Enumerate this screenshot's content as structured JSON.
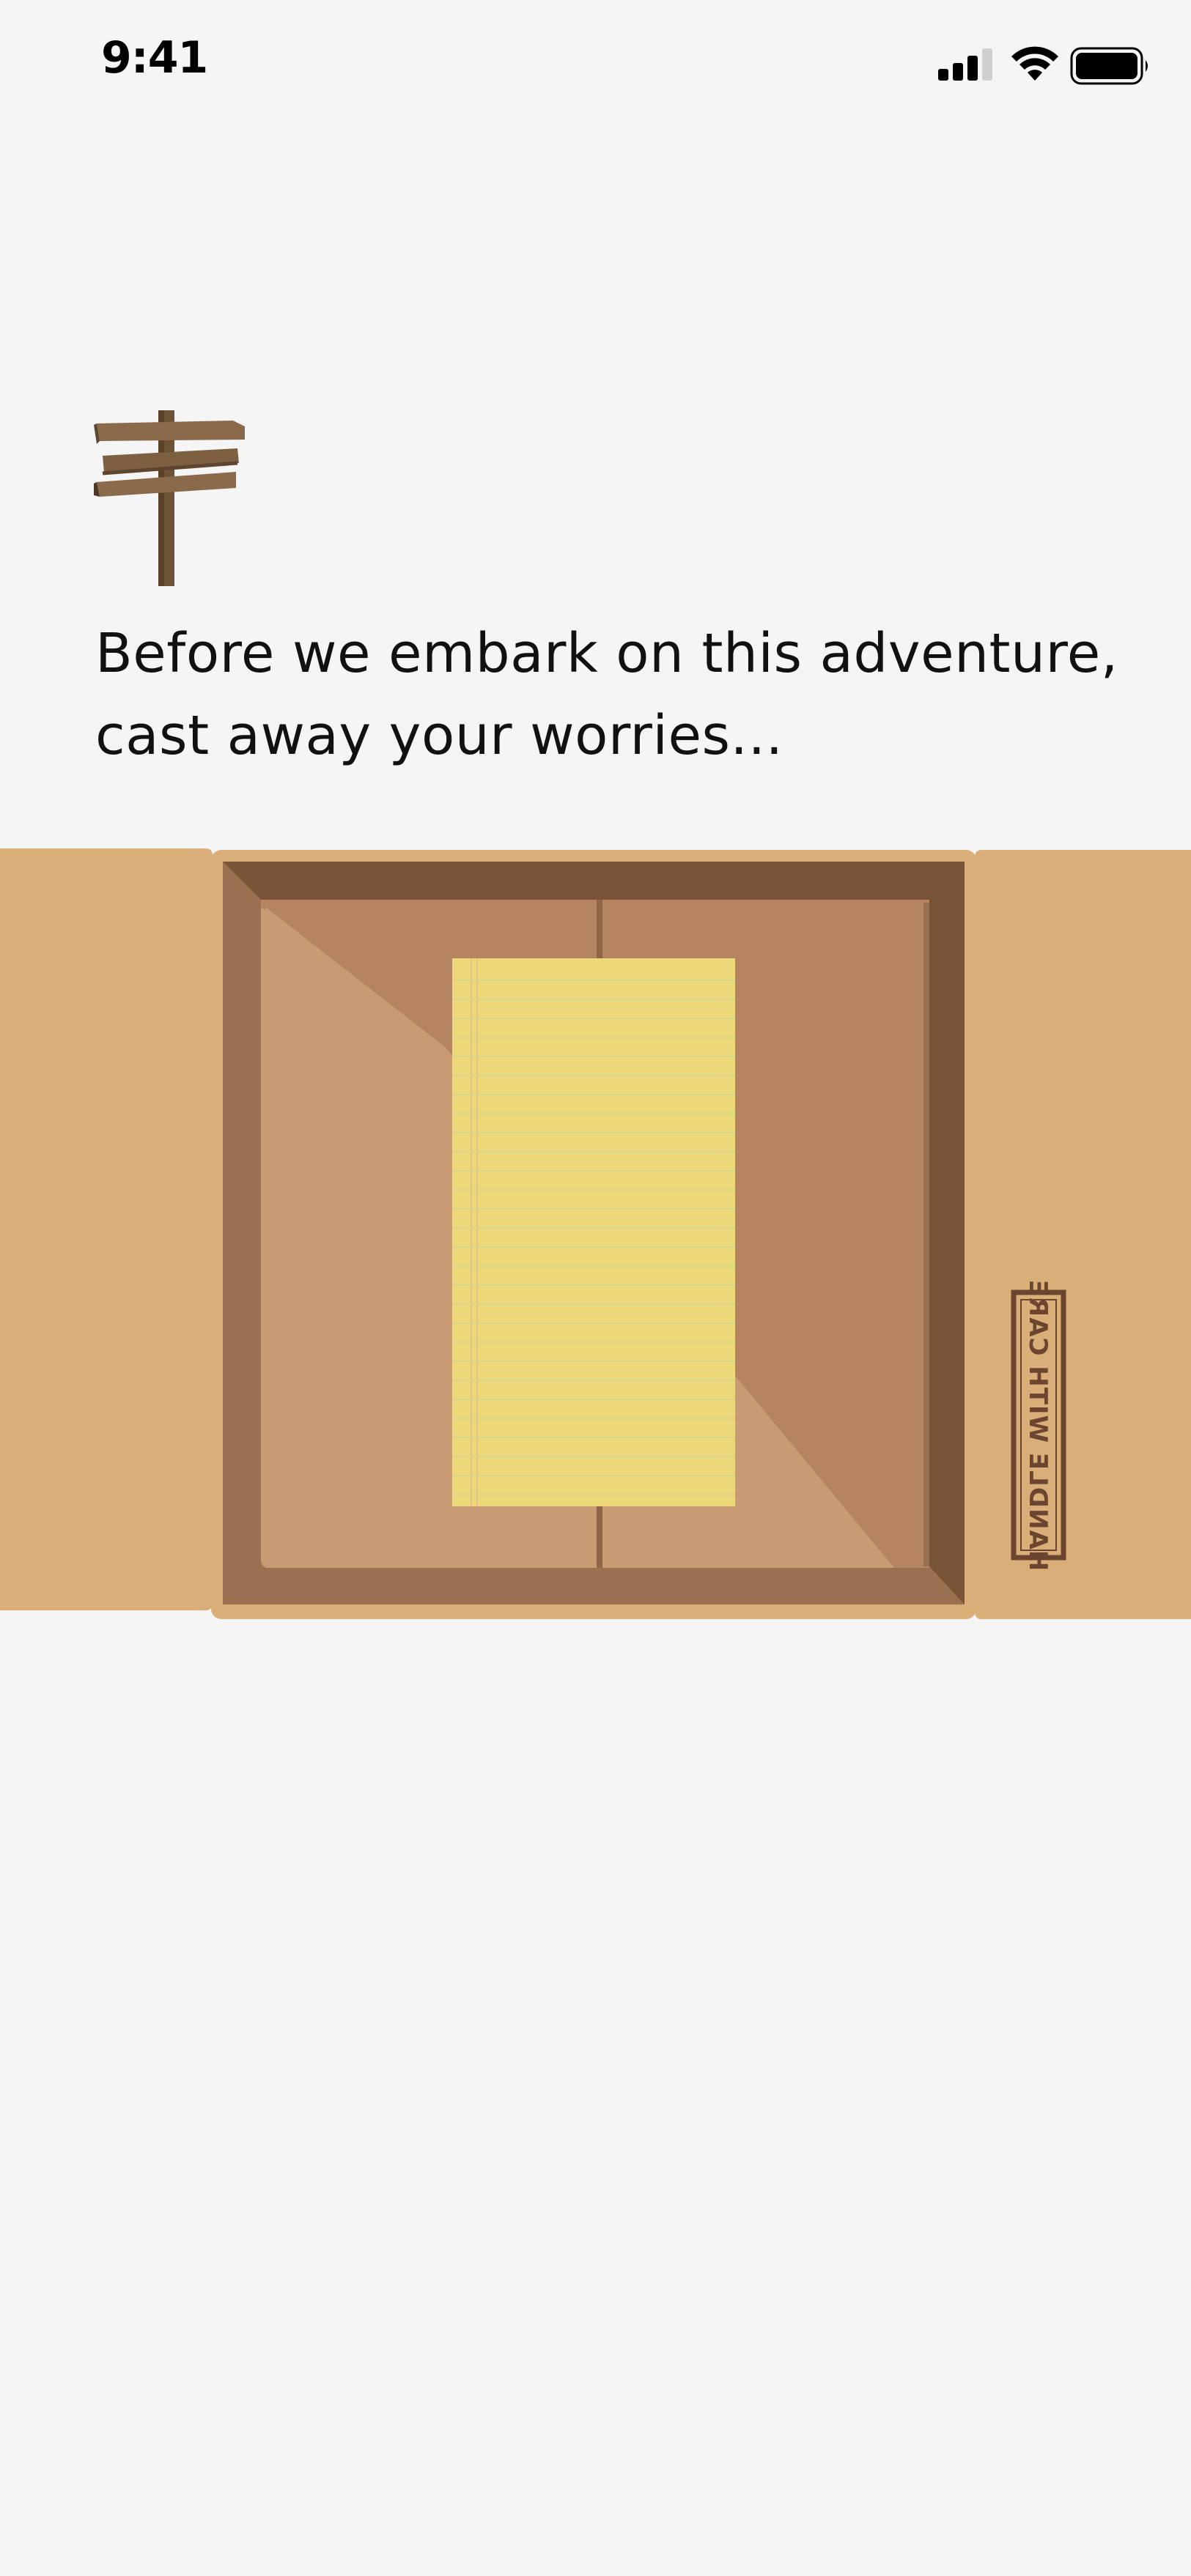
{
  "status_bar": {
    "time": "9:41",
    "icons": [
      "signal-icon",
      "wifi-icon",
      "battery-icon"
    ]
  },
  "header_icon": "signpost-icon",
  "intro": {
    "line1": "Before we embark on this adventure,",
    "line2": "cast away your worries..."
  },
  "box": {
    "label": "HANDLE WITH CARE",
    "contents": "yellow-notepad"
  },
  "colors": {
    "background": "#f5f5f5",
    "cardboard": "#d9ae79",
    "box_inner_dark": "#7a5438",
    "notepad": "#ecd97a"
  }
}
